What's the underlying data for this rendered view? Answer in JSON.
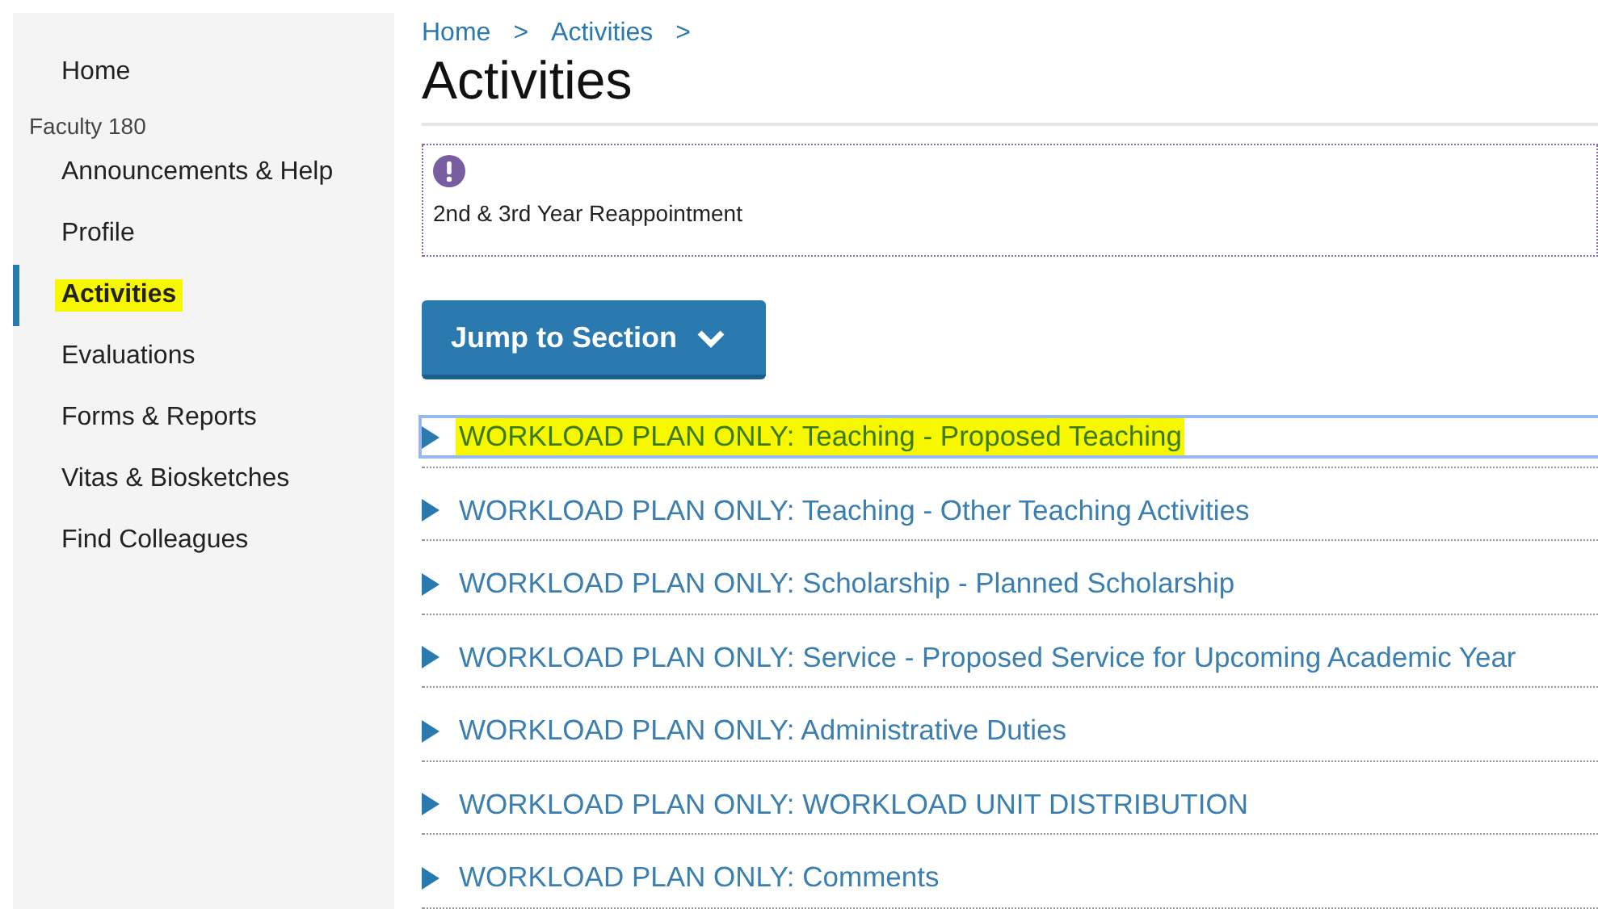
{
  "sidebar": {
    "items": [
      {
        "kind": "link",
        "label": "Home",
        "selected": false,
        "highlighted": false
      },
      {
        "kind": "heading",
        "label": "Faculty 180"
      },
      {
        "kind": "link",
        "label": "Announcements & Help",
        "selected": false,
        "highlighted": false
      },
      {
        "kind": "link",
        "label": "Profile",
        "selected": false,
        "highlighted": false
      },
      {
        "kind": "link",
        "label": "Activities",
        "selected": true,
        "highlighted": true
      },
      {
        "kind": "link",
        "label": "Evaluations",
        "selected": false,
        "highlighted": false
      },
      {
        "kind": "link",
        "label": "Forms & Reports",
        "selected": false,
        "highlighted": false
      },
      {
        "kind": "link",
        "label": "Vitas & Biosketches",
        "selected": false,
        "highlighted": false
      },
      {
        "kind": "link",
        "label": "Find Colleagues",
        "selected": false,
        "highlighted": false
      }
    ]
  },
  "breadcrumb": {
    "items": [
      "Home",
      "Activities"
    ],
    "separator": ">"
  },
  "page_title": "Activities",
  "notice": {
    "text": "2nd & 3rd Year Reappointment"
  },
  "jump_button": {
    "label": "Jump to Section"
  },
  "sections": [
    {
      "title": "WORKLOAD PLAN ONLY: Teaching - Proposed Teaching",
      "focused": true,
      "highlighted": true
    },
    {
      "title": "WORKLOAD PLAN ONLY: Teaching - Other Teaching Activities",
      "focused": false,
      "highlighted": false
    },
    {
      "title": "WORKLOAD PLAN ONLY: Scholarship - Planned Scholarship",
      "focused": false,
      "highlighted": false
    },
    {
      "title": "WORKLOAD PLAN ONLY: Service - Proposed Service for Upcoming Academic Year",
      "focused": false,
      "highlighted": false
    },
    {
      "title": "WORKLOAD PLAN ONLY: Administrative Duties",
      "focused": false,
      "highlighted": false
    },
    {
      "title": "WORKLOAD PLAN ONLY: WORKLOAD UNIT DISTRIBUTION",
      "focused": false,
      "highlighted": false
    },
    {
      "title": "WORKLOAD PLAN ONLY: Comments",
      "focused": false,
      "highlighted": false
    }
  ]
}
